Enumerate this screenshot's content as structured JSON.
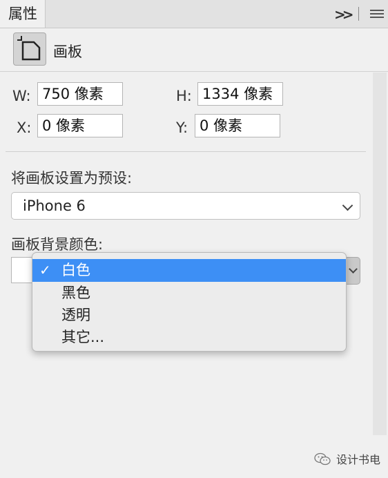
{
  "panel": {
    "tab_title": "属性",
    "expand_icon": "double-chevron-right",
    "menu_icon": "hamburger-menu"
  },
  "header": {
    "tool_icon": "artboard-icon",
    "title": "画板"
  },
  "dimensions": {
    "w_label": "W:",
    "w_value": "750 像素",
    "h_label": "H:",
    "h_value": "1334 像素",
    "x_label": "X:",
    "x_value": "0 像素",
    "y_label": "Y:",
    "y_value": "0 像素"
  },
  "preset": {
    "label": "将画板设置为预设:",
    "selected": "iPhone 6"
  },
  "background": {
    "label": "画板背景颜色:",
    "swatch_color": "#ffffff",
    "options": [
      "白色",
      "黑色",
      "透明",
      "其它..."
    ],
    "selected_index": 0,
    "check": "✓"
  },
  "colors": {
    "highlight": "#3d8ff5"
  },
  "watermark": {
    "icon": "wechat-icon",
    "text": "设计书电"
  }
}
